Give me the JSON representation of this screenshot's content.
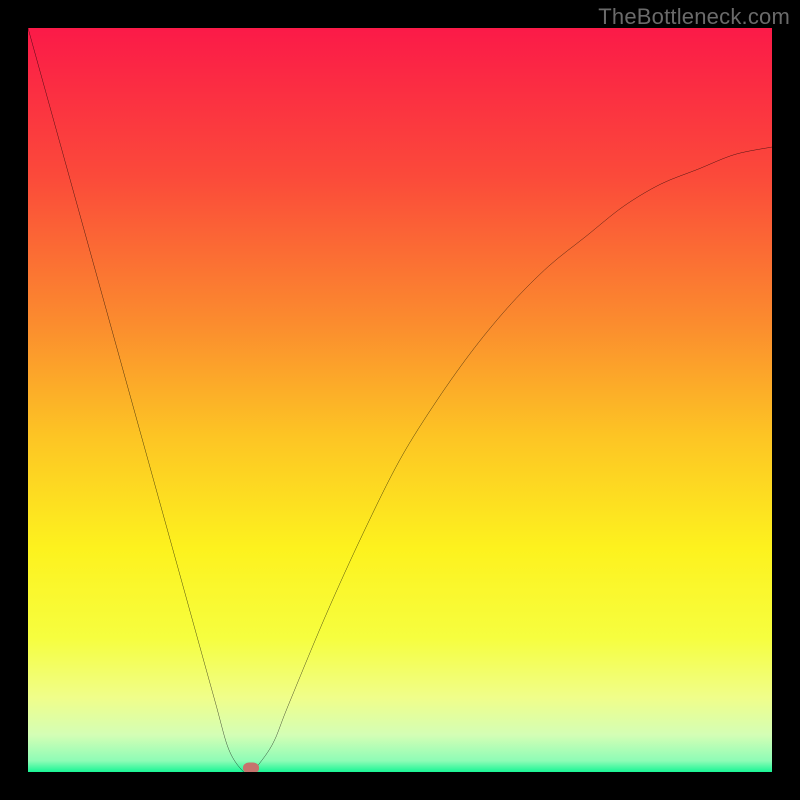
{
  "attribution": "TheBottleneck.com",
  "colors": {
    "frame": "#000000",
    "gradient_stops": [
      {
        "pos": 0.0,
        "color": "#fb1a48"
      },
      {
        "pos": 0.2,
        "color": "#fb4a3a"
      },
      {
        "pos": 0.4,
        "color": "#fb8d2e"
      },
      {
        "pos": 0.55,
        "color": "#fdc524"
      },
      {
        "pos": 0.7,
        "color": "#fdf21e"
      },
      {
        "pos": 0.82,
        "color": "#f6fe3f"
      },
      {
        "pos": 0.9,
        "color": "#f0fe8a"
      },
      {
        "pos": 0.95,
        "color": "#d4feb5"
      },
      {
        "pos": 0.985,
        "color": "#8efcb6"
      },
      {
        "pos": 1.0,
        "color": "#19f595"
      }
    ],
    "curve": "#000000",
    "marker": "#c6736d"
  },
  "chart_data": {
    "type": "line",
    "title": "",
    "xlabel": "",
    "ylabel": "",
    "xlim": [
      0,
      100
    ],
    "ylim": [
      0,
      100
    ],
    "grid": false,
    "legend": false,
    "series": [
      {
        "name": "bottleneck-curve",
        "x": [
          0,
          5,
          10,
          15,
          20,
          25,
          27,
          29,
          30,
          31,
          33,
          35,
          40,
          45,
          50,
          55,
          60,
          65,
          70,
          75,
          80,
          85,
          90,
          95,
          100
        ],
        "y": [
          100,
          82,
          64,
          46,
          28,
          10,
          3,
          0,
          0,
          1,
          4,
          9,
          21,
          32,
          42,
          50,
          57,
          63,
          68,
          72,
          76,
          79,
          81,
          83,
          84
        ]
      }
    ],
    "marker": {
      "x": 30,
      "y": 0.6
    }
  }
}
